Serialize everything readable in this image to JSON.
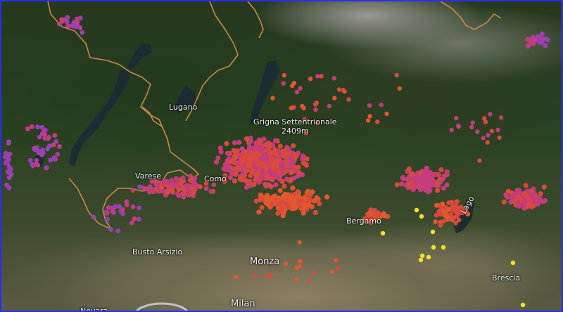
{
  "map": {
    "labels": {
      "lugano": "Lugano",
      "grigna": "Grigna Settentrionale",
      "grigna_elev": "2409m",
      "varese": "Varese",
      "como": "Como",
      "bergamo": "Bergamo",
      "lake": "Lago",
      "busto": "Busto Arsizio",
      "monza": "Monza",
      "milan": "Milan",
      "brescia": "Brescia",
      "novara": "Novara"
    },
    "colors": {
      "border": "#c88a4a",
      "lake": "#1a2a33",
      "purple": "#9b3fb5",
      "magenta": "#c43c7e",
      "red": "#d94a3c",
      "orange": "#e4572e",
      "yellow": "#f5e12a"
    }
  }
}
